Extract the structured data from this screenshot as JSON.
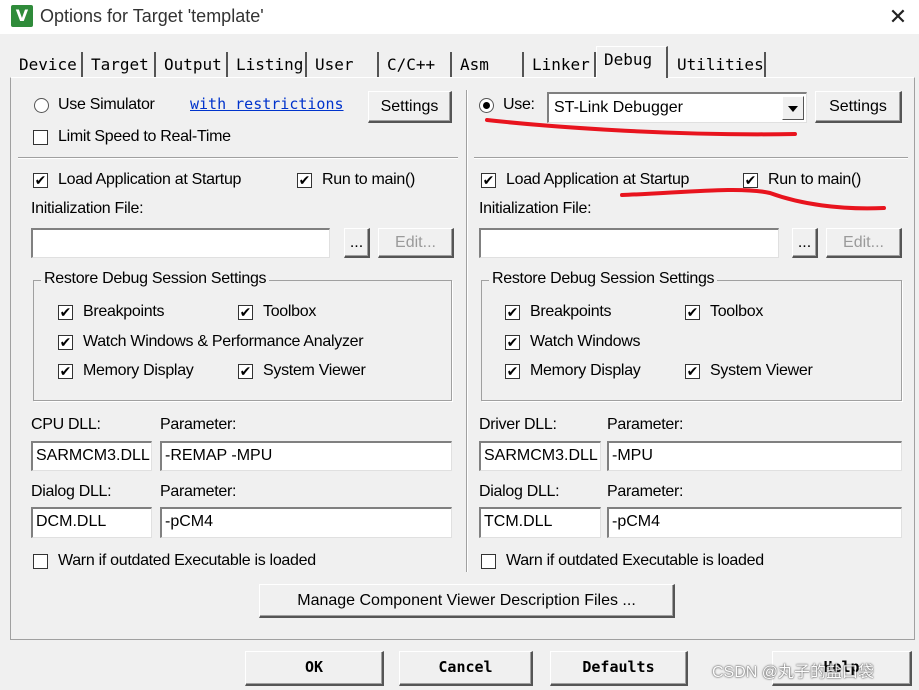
{
  "window": {
    "title": "Options for Target 'template'",
    "close_glyph": "✕",
    "app_icon_letter": "V"
  },
  "tabs": [
    {
      "label": "Device"
    },
    {
      "label": "Target"
    },
    {
      "label": "Output"
    },
    {
      "label": "Listing"
    },
    {
      "label": "User"
    },
    {
      "label": "C/C++"
    },
    {
      "label": "Asm"
    },
    {
      "label": "Linker"
    },
    {
      "label": "Debug",
      "active": true
    },
    {
      "label": "Utilities"
    }
  ],
  "left": {
    "use_simulator": "Use Simulator",
    "restrictions_link": "with restrictions",
    "settings_label": "Settings",
    "limit_speed": "Limit Speed to Real-Time",
    "load_app": "Load Application at Startup",
    "run_to_main": "Run to main()",
    "init_file_label": "Initialization File:",
    "init_file_value": "",
    "browse_label": "...",
    "edit_label": "Edit...",
    "restore_title": "Restore Debug Session Settings",
    "breakpoints": "Breakpoints",
    "toolbox": "Toolbox",
    "watch_windows": "Watch Windows & Performance Analyzer",
    "memory_display": "Memory Display",
    "system_viewer": "System Viewer",
    "dll_label": "CPU DLL:",
    "dll_param_label": "Parameter:",
    "dll_value": "SARMCM3.DLL",
    "dll_param_value": "-REMAP -MPU",
    "dialog_dll_label": "Dialog DLL:",
    "dialog_param_label": "Parameter:",
    "dialog_dll_value": "DCM.DLL",
    "dialog_param_value": "-pCM4",
    "warn_outdated": "Warn if outdated Executable is loaded"
  },
  "right": {
    "use_label": "Use:",
    "debugger_value": "ST-Link Debugger",
    "settings_label": "Settings",
    "load_app": "Load Application at Startup",
    "run_to_main": "Run to main()",
    "init_file_label": "Initialization File:",
    "init_file_value": "",
    "browse_label": "...",
    "edit_label": "Edit...",
    "restore_title": "Restore Debug Session Settings",
    "breakpoints": "Breakpoints",
    "toolbox": "Toolbox",
    "watch_windows": "Watch Windows",
    "memory_display": "Memory Display",
    "system_viewer": "System Viewer",
    "dll_label": "Driver DLL:",
    "dll_param_label": "Parameter:",
    "dll_value": "SARMCM3.DLL",
    "dll_param_value": "-MPU",
    "dialog_dll_label": "Dialog DLL:",
    "dialog_param_label": "Parameter:",
    "dialog_dll_value": "TCM.DLL",
    "dialog_param_value": "-pCM4",
    "warn_outdated": "Warn if outdated Executable is loaded"
  },
  "manage_button": "Manage Component Viewer Description Files ...",
  "footer": {
    "ok": "OK",
    "cancel": "Cancel",
    "defaults": "Defaults",
    "help": "Help"
  },
  "watermark": "CSDN @丸子的盐口袋",
  "check_glyph": "✔",
  "annotation_color": "#e8141e"
}
